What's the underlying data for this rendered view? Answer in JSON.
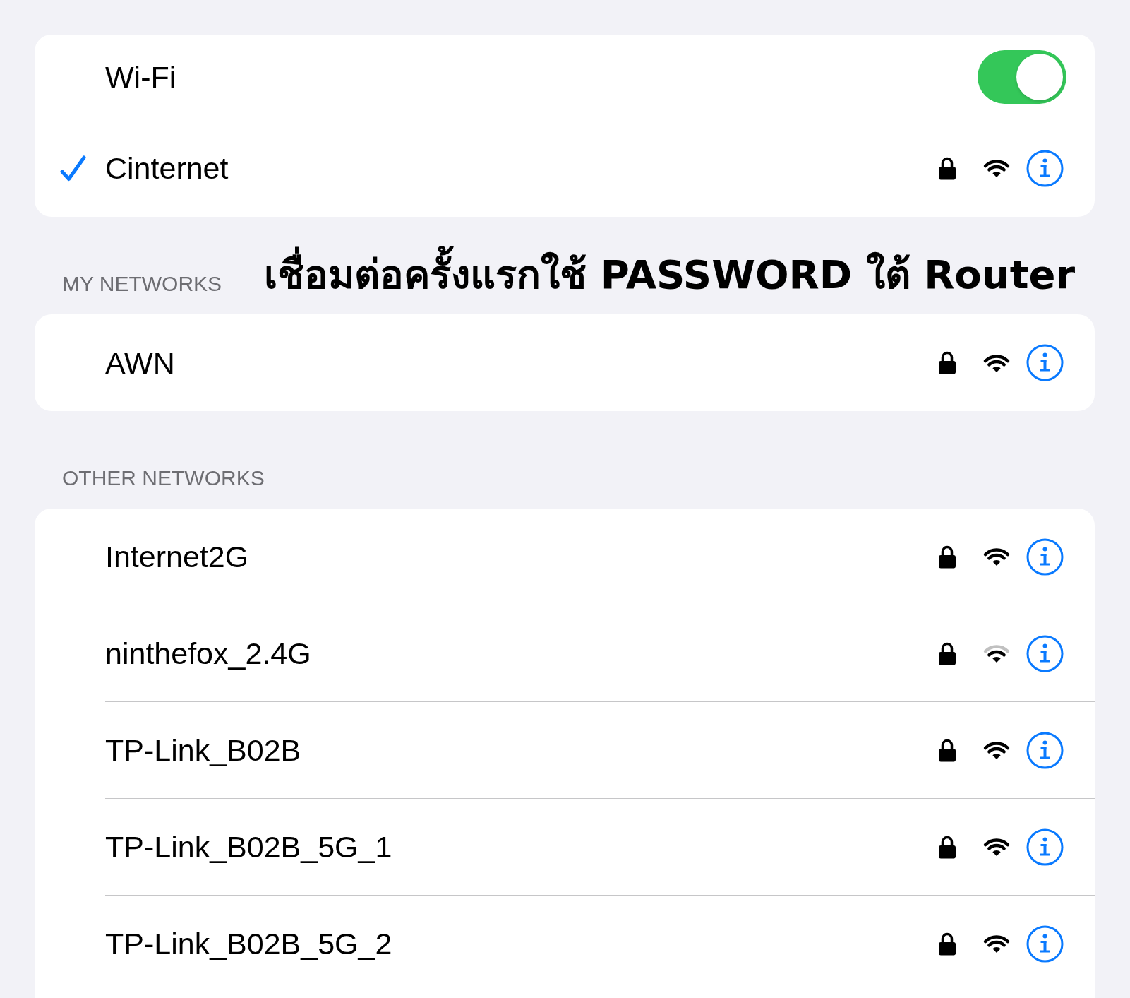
{
  "wifi": {
    "label": "Wi-Fi",
    "on": true
  },
  "current_network": {
    "name": "Cinternet",
    "connected": true,
    "secured": true,
    "full_signal": true
  },
  "my_networks": {
    "heading": "MY NETWORKS",
    "caption": "เชื่อมต่อครั้งแรกใช้ PASSWORD ใต้ Router",
    "networks": [
      {
        "name": "AWN",
        "connected": false,
        "secured": true,
        "full_signal": true
      }
    ]
  },
  "other_networks": {
    "heading": "OTHER NETWORKS",
    "networks": [
      {
        "name": "Internet2G",
        "connected": false,
        "secured": true,
        "full_signal": true
      },
      {
        "name": "ninthefox_2.4G",
        "connected": false,
        "secured": true,
        "full_signal": false
      },
      {
        "name": "TP-Link_B02B",
        "connected": false,
        "secured": true,
        "full_signal": true
      },
      {
        "name": "TP-Link_B02B_5G_1",
        "connected": false,
        "secured": true,
        "full_signal": true
      },
      {
        "name": "TP-Link_B02B_5G_2",
        "connected": false,
        "secured": true,
        "full_signal": true
      }
    ]
  }
}
